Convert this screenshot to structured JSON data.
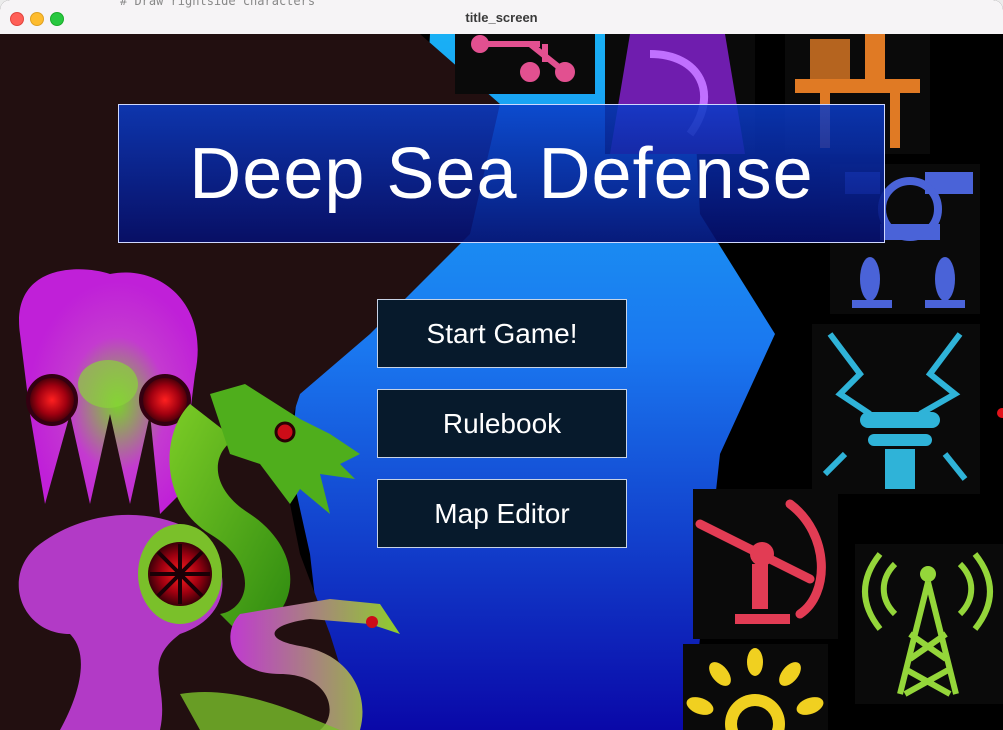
{
  "window": {
    "title": "title_screen",
    "background_code_snippet": "# Draw rightside characters"
  },
  "game": {
    "title": "Deep Sea Defense",
    "menu": [
      {
        "id": "start",
        "label": "Start Game!"
      },
      {
        "id": "rulebook",
        "label": "Rulebook"
      },
      {
        "id": "map-editor",
        "label": "Map Editor"
      }
    ]
  },
  "colors": {
    "title_panel": "#0b2ab8",
    "button_bg": "#071a2c",
    "water_top": "#1aa8f0",
    "water_bottom": "#0a0fb0",
    "left_rock": "#220f10"
  },
  "icons": {
    "left": [
      "squid-monster-icon",
      "sea-serpent-dragon-icon",
      "eel-monster-icon",
      "tentacle-creature-icon"
    ],
    "right": [
      "sub-circuit-icon",
      "squid-banner-icon",
      "oil-rig-icon",
      "mech-walker-icon",
      "lightning-tesla-tower-icon",
      "radar-dish-icon",
      "radio-tower-icon",
      "sun-burst-icon"
    ]
  }
}
